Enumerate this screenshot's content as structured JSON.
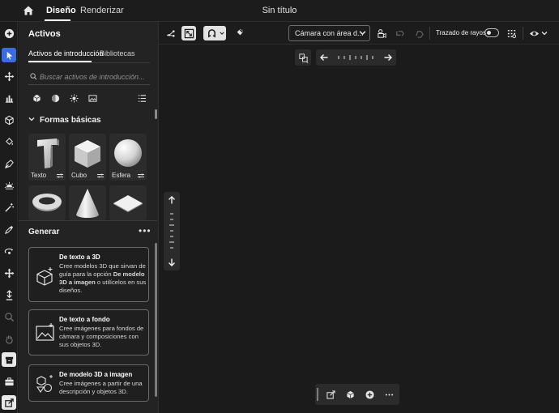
{
  "topbar": {
    "tabs": [
      {
        "label": "Diseño",
        "active": true
      },
      {
        "label": "Renderizar",
        "active": false
      }
    ],
    "document_title": "Sin título"
  },
  "toolbar": {
    "tools": [
      "add-icon",
      "select-icon",
      "move-icon",
      "chart-icon",
      "cube-icon",
      "paint-bucket-icon",
      "pen-icon",
      "light-icon",
      "magic-wand-icon",
      "eyedropper-icon",
      "orbit-icon",
      "pan-icon",
      "dolly-icon",
      "zoom-icon",
      "hand-icon",
      "archive-icon",
      "briefcase-icon",
      "export-icon"
    ]
  },
  "panel": {
    "title": "Activos",
    "subtabs": [
      "Activos de introducción",
      "Bibliotecas"
    ],
    "search_placeholder": "Buscar activos de introducción...",
    "filters": [
      "models-filter-icon",
      "materials-filter-icon",
      "lights-filter-icon",
      "images-filter-icon",
      "list-view-icon"
    ],
    "section_title": "Formas básicas",
    "shapes": [
      {
        "label": "Texto"
      },
      {
        "label": "Cubo"
      },
      {
        "label": "Esfera"
      },
      {
        "label": ""
      },
      {
        "label": ""
      },
      {
        "label": ""
      }
    ]
  },
  "generate": {
    "title": "Generar",
    "more": "•••",
    "cards": [
      {
        "title": "De texto a 3D",
        "desc_parts": [
          "Cree modelos 3D que sirvan de guía para la opción ",
          "De modelo 3D a imagen",
          " o utilícelos en sus diseños."
        ]
      },
      {
        "title": "De texto a fondo",
        "desc_parts": [
          "Cree imágenes para fondos de cámara y composiciones con sus objetos 3D.",
          "",
          ""
        ]
      },
      {
        "title": "De modelo 3D a imagen",
        "desc_parts": [
          "Cree imágenes a partir de una descripción y objetos 3D.",
          "",
          ""
        ]
      }
    ]
  },
  "viewport_toolbar": {
    "camera_select": "Cámara con área d...",
    "raytrace_label": "Trazado de rayos",
    "raytrace_on": false
  },
  "colors": {
    "accent": "#3b6be0",
    "background": "#1b1b1b",
    "panel": "#232323"
  }
}
